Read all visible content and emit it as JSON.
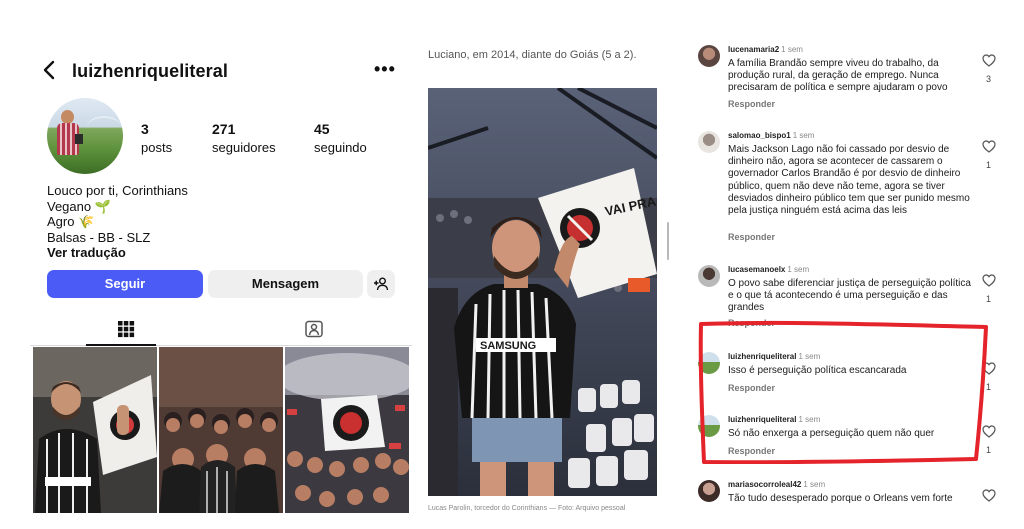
{
  "profile": {
    "username": "luizhenriqueliteral",
    "more_icon_text": "•••",
    "stats": [
      {
        "value": "3",
        "label": "posts"
      },
      {
        "value": "271",
        "label": "seguidores"
      },
      {
        "value": "45",
        "label": "seguindo"
      }
    ],
    "bio_lines": [
      "Louco por ti, Corinthians",
      "Vegano 🌱",
      "Agro 🌾",
      "Balsas - BB - SLZ"
    ],
    "translate_link": "Ver tradução",
    "follow_button": "Seguir",
    "message_button": "Mensagem",
    "accent_color": "#4b5cf6"
  },
  "article": {
    "caption": "Luciano, em 2014, diante do Goiás (5 a 2).",
    "credit": "Lucas Parolin, torcedor do Corinthians — Foto: Arquivo pessoal",
    "photo_shirt_text": "SAMSUNG",
    "photo_flag_text": "VAI PRA CIMA TIMÃO"
  },
  "comments": [
    {
      "user": "lucenamaria2",
      "time": "1 sem",
      "text": "A família Brandão sempre viveu do trabalho, da produção rural, da geração de emprego. Nunca precisaram de política e sempre ajudaram o povo",
      "reply": "Responder",
      "likes": "3"
    },
    {
      "user": "salomao_bispo1",
      "time": "1 sem",
      "text": "Mais Jackson Lago não foi cassado por desvio de dinheiro não, agora se acontecer de cassarem o governador Carlos Brandão é por desvio de dinheiro público, quem não deve não teme,  agora se tiver desviados dinheiro público tem que ser punido mesmo pela justiça ninguém está acima das leis",
      "reply": "Responder",
      "likes": "1"
    },
    {
      "user": "lucasemanoelx",
      "time": "1 sem",
      "text": "O povo sabe diferenciar justiça de perseguição política e o que tá acontecendo é uma perseguição e das grandes",
      "reply": "Responder",
      "likes": "1"
    },
    {
      "user": "luizhenriqueliteral",
      "time": "1 sem",
      "text": "Isso é perseguição política escancarada",
      "reply": "Responder",
      "likes": "1"
    },
    {
      "user": "luizhenriqueliteral",
      "time": "1 sem",
      "text": "Só não enxerga a perseguição quem não quer",
      "reply": "Responder",
      "likes": "1"
    },
    {
      "user": "mariasocorroleal42",
      "time": "1 sem",
      "text": "Tão tudo desesperado porque o Orleans vem forte",
      "reply": "",
      "likes": ""
    }
  ],
  "highlight_color": "#e4232a"
}
